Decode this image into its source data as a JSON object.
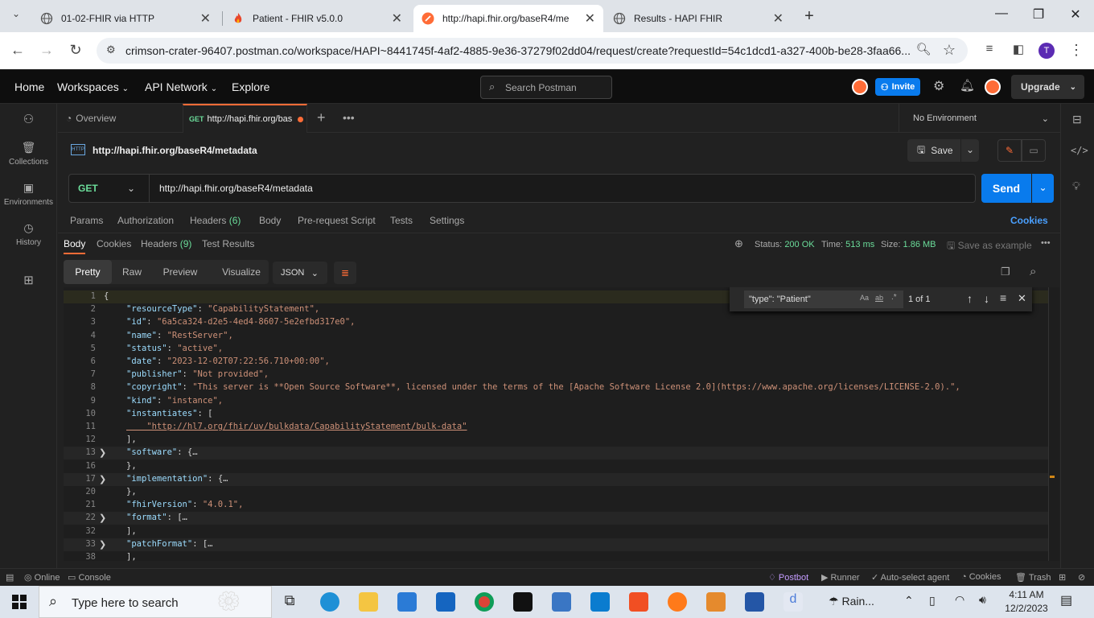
{
  "browser": {
    "tabs": [
      {
        "title": "01-02-FHIR via HTTP"
      },
      {
        "title": "Patient - FHIR v5.0.0"
      },
      {
        "title": "http://hapi.fhir.org/baseR4/me"
      },
      {
        "title": "Results - HAPI FHIR"
      }
    ],
    "url": "crimson-crater-96407.postman.co/workspace/HAPI~8441745f-4af2-4885-9e36-37279f02dd04/request/create?requestId=54c1dcd1-a327-400b-be28-3faa66...",
    "profile_initial": "T"
  },
  "postman": {
    "nav": [
      "Home",
      "Workspaces",
      "API Network",
      "Explore"
    ],
    "search_placeholder": "Search Postman",
    "invite_label": "Invite",
    "upgrade_label": "Upgrade",
    "sidebar": [
      "Collections",
      "Environments",
      "History"
    ],
    "tabs": {
      "overview": "Overview",
      "active_method": "GET",
      "active_title": "http://hapi.fhir.org/bas"
    },
    "environment": "No Environment",
    "request": {
      "title": "http://hapi.fhir.org/baseR4/metadata",
      "method": "GET",
      "url": "http://hapi.fhir.org/baseR4/metadata",
      "save_label": "Save",
      "send_label": "Send",
      "http_badge": "HTTP"
    },
    "req_tabs": [
      "Params",
      "Authorization",
      "Headers",
      "Body",
      "Pre-request Script",
      "Tests",
      "Settings"
    ],
    "req_headers_count": "(6)",
    "cookies_link": "Cookies",
    "res_tabs": [
      "Body",
      "Cookies",
      "Headers",
      "Test Results"
    ],
    "res_headers_count": "(9)",
    "response": {
      "status_label": "Status:",
      "status": "200 OK",
      "time_label": "Time:",
      "time": "513 ms",
      "size_label": "Size:",
      "size": "1.86 MB",
      "save_example": "Save as example"
    },
    "view_modes": [
      "Pretty",
      "Raw",
      "Preview",
      "Visualize"
    ],
    "format": "JSON",
    "find": {
      "query": "\"type\": \"Patient\"",
      "count": "1 of 1",
      "opt_case": "Aa",
      "opt_word": "ab",
      "opt_regex": ".*"
    },
    "code_lines": [
      {
        "n": "1",
        "t": "{"
      },
      {
        "n": "2",
        "k": "\"resourceType\"",
        "v": "\"CapabilityStatement\","
      },
      {
        "n": "3",
        "k": "\"id\"",
        "v": "\"6a5ca324-d2e5-4ed4-8607-5e2efbd317e0\","
      },
      {
        "n": "4",
        "k": "\"name\"",
        "v": "\"RestServer\","
      },
      {
        "n": "5",
        "k": "\"status\"",
        "v": "\"active\","
      },
      {
        "n": "6",
        "k": "\"date\"",
        "v": "\"2023-12-02T07:22:56.710+00:00\","
      },
      {
        "n": "7",
        "k": "\"publisher\"",
        "v": "\"Not provided\","
      },
      {
        "n": "8",
        "k": "\"copyright\"",
        "v": "\"This server is **Open Source Software**, licensed under the terms of the [Apache Software License 2.0](https://www.apache.org/licenses/LICENSE-2.0).\","
      },
      {
        "n": "9",
        "k": "\"kind\"",
        "v": "\"instance\","
      },
      {
        "n": "10",
        "k": "\"instantiates\"",
        "v": "["
      },
      {
        "n": "11",
        "t": "    \"http://hl7.org/fhir/uv/bulkdata/CapabilityStatement/bulk-data\""
      },
      {
        "n": "12",
        "t": "],"
      },
      {
        "n": "13",
        "k": "\"software\"",
        "v": "{…",
        "fold": true
      },
      {
        "n": "16",
        "t": "},"
      },
      {
        "n": "17",
        "k": "\"implementation\"",
        "v": "{…",
        "fold": true
      },
      {
        "n": "20",
        "t": "},"
      },
      {
        "n": "21",
        "k": "\"fhirVersion\"",
        "v": "\"4.0.1\","
      },
      {
        "n": "22",
        "k": "\"format\"",
        "v": "[…",
        "fold": true
      },
      {
        "n": "32",
        "t": "],"
      },
      {
        "n": "33",
        "k": "\"patchFormat\"",
        "v": "[…",
        "fold": true
      },
      {
        "n": "38",
        "t": "],"
      }
    ],
    "statusbar": {
      "online": "Online",
      "console": "Console",
      "postbot": "Postbot",
      "runner": "Runner",
      "agent": "Auto-select agent",
      "cookies": "Cookies",
      "trash": "Trash"
    }
  },
  "taskbar": {
    "search_placeholder": "Type here to search",
    "weather": "Rain...",
    "time": "4:11 AM",
    "date": "12/2/2023"
  }
}
